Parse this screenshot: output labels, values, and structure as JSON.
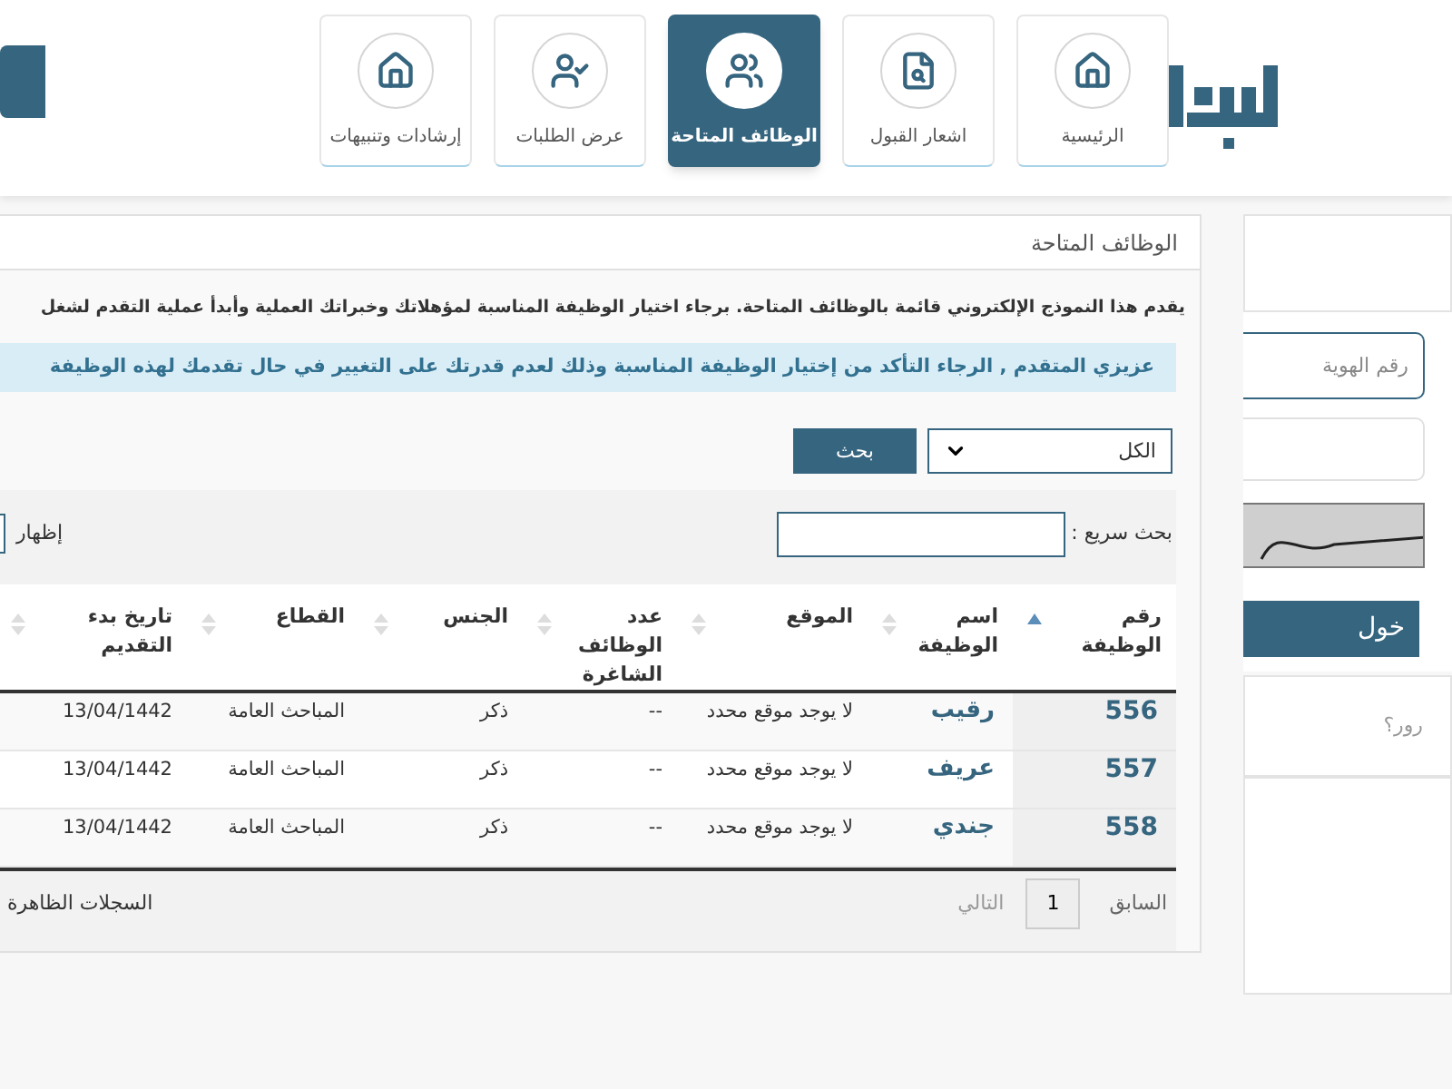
{
  "header": {
    "nav": [
      {
        "label": "الرئيسية",
        "kind": "home",
        "selected": false
      },
      {
        "label": "اشعار القبول",
        "kind": "document",
        "selected": false
      },
      {
        "label": "الوظائف المتاحة",
        "kind": "group",
        "selected": true
      },
      {
        "label": "عرض الطلبات",
        "kind": "user",
        "selected": false
      },
      {
        "label": "إرشادات وتنبيهات",
        "kind": "home",
        "selected": false
      }
    ]
  },
  "main": {
    "title": "الوظائف المتاحة",
    "description": "يقدم هذا النموذج الإلكتروني قائمة بالوظائف المتاحة. برجاء اختيار الوظيفة المناسبة لمؤهلاتك وخبراتك العملية وأبدأ عملية التقدم لشغل",
    "notice": "عزيزي المتقدم , الرجاء التأكد من إختيار الوظيفة المناسبة وذلك لعدم قدرتك على التغيير في حال تقدمك لهذه الوظيفة",
    "filter": {
      "value": "الكل",
      "button": "بحث"
    },
    "quick_search": {
      "label": "بحث سريع :"
    },
    "show_label": "إظهار",
    "table": {
      "columns": [
        {
          "label": "رقم الوظيفة",
          "sorted": true
        },
        {
          "label": "اسم الوظيفة",
          "sorted": false
        },
        {
          "label": "الموقع",
          "sorted": false
        },
        {
          "label": "عدد الوظائف الشاغرة",
          "sorted": false
        },
        {
          "label": "الجنس",
          "sorted": false
        },
        {
          "label": "القطاع",
          "sorted": false
        },
        {
          "label": "تاريخ بدء التقديم",
          "sorted": false
        }
      ],
      "rows": [
        [
          "556",
          "رقيب",
          "لا يوجد موقع محدد",
          "--",
          "ذكر",
          "المباحث العامة",
          "13/04/1442"
        ],
        [
          "557",
          "عريف",
          "لا يوجد موقع محدد",
          "--",
          "ذكر",
          "المباحث العامة",
          "13/04/1442"
        ],
        [
          "558",
          "جندي",
          "لا يوجد موقع محدد",
          "--",
          "ذكر",
          "المباحث العامة",
          "13/04/1442"
        ]
      ]
    },
    "pagination": {
      "previous": "السابق",
      "page": "1",
      "next": "التالي"
    },
    "records_label": "السجلات الظاهرة"
  },
  "login": {
    "id_placeholder": "رقم الهوية",
    "submit": "خول",
    "forgot": "رور؟"
  }
}
